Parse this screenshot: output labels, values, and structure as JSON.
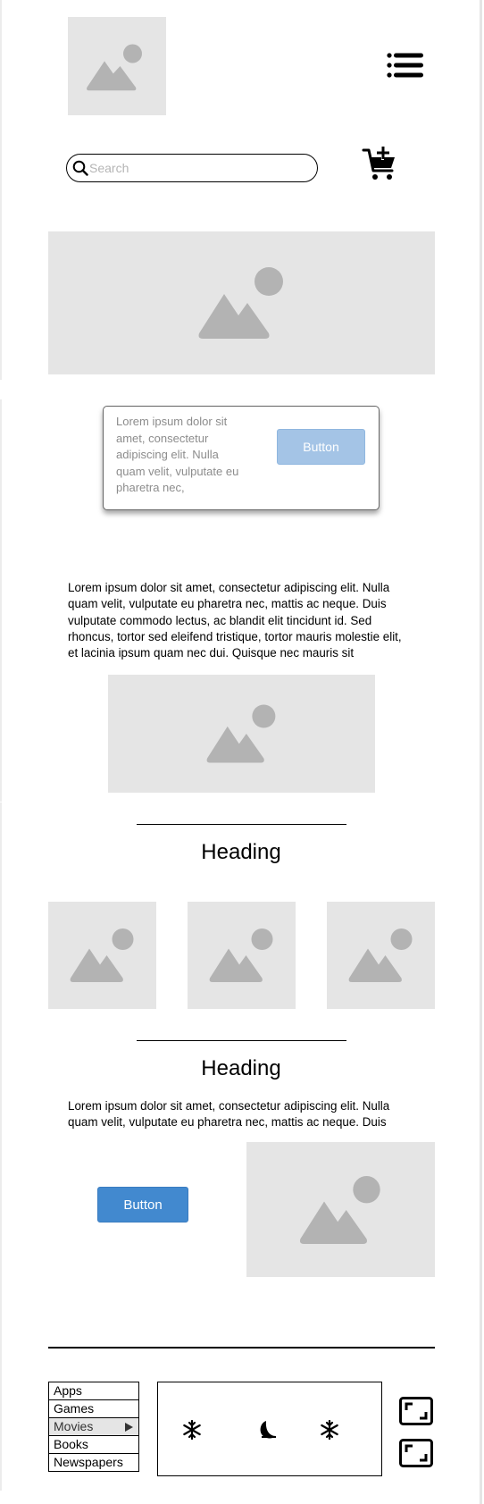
{
  "header": {
    "logo_icon": "image-placeholder-icon",
    "menu_icon": "menu-list-icon",
    "cart_icon": "add-to-cart-icon"
  },
  "search": {
    "placeholder": "Search",
    "value": "",
    "icon": "search-icon"
  },
  "card": {
    "text": "Lorem ipsum dolor sit amet, consectetur adipiscing elit. Nulla quam velit, vulputate eu pharetra nec,",
    "button_label": "Button"
  },
  "content": {
    "paragraph1": "Lorem ipsum dolor sit amet, consectetur adipiscing elit. Nulla quam velit, vulputate eu pharetra nec, mattis ac neque. Duis vulputate commodo lectus, ac blandit elit tincidunt id. Sed rhoncus, tortor sed eleifend tristique, tortor mauris molestie elit, et lacinia ipsum quam nec dui. Quisque nec mauris sit",
    "heading1": "Heading",
    "heading2": "Heading",
    "paragraph2": "Lorem ipsum dolor sit amet, consectetur adipiscing elit. Nulla quam velit, vulputate eu pharetra nec, mattis ac neque. Duis",
    "button_label": "Button"
  },
  "footer": {
    "menu_items": [
      {
        "label": "Apps",
        "active": false
      },
      {
        "label": "Games",
        "active": false
      },
      {
        "label": "Movies",
        "active": true,
        "has_submenu": true
      },
      {
        "label": "Books",
        "active": false
      },
      {
        "label": "Newspapers",
        "active": false
      }
    ],
    "weather_icons": [
      "snowflake-icon",
      "moon-icon",
      "snowflake-icon"
    ],
    "side_icons": [
      "expand-icon",
      "expand-icon"
    ]
  },
  "colors": {
    "placeholder_bg": "#e5e5e5",
    "placeholder_fg": "#b3b3b3",
    "button_primary": "#4289cf",
    "button_disabled": "#a4c4e6"
  }
}
